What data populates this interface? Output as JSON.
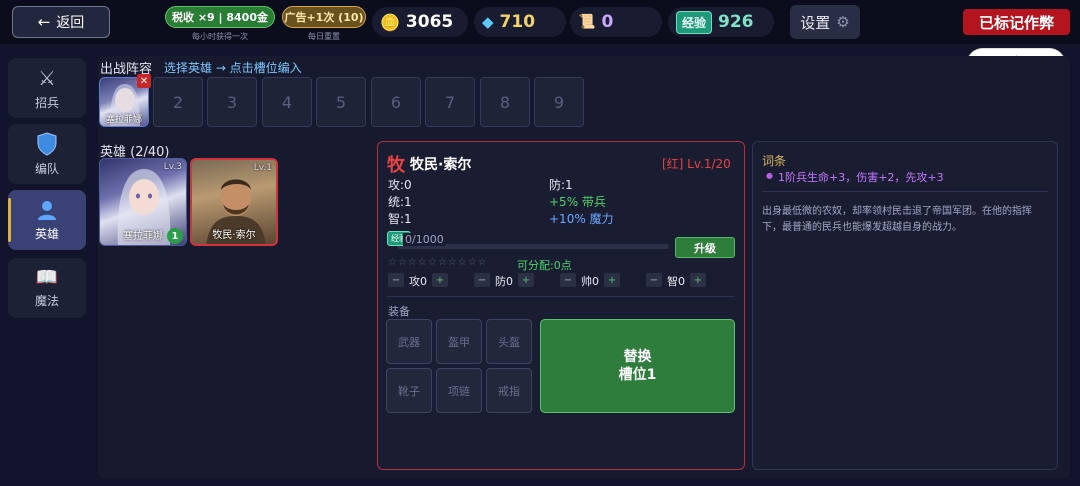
{
  "topbar": {
    "back_label": "返回",
    "tax_label": "税收 ×9 | 8400金",
    "tax_sub": "每小时获得一次",
    "ad_label": "广告+1次 (10)",
    "ad_sub": "每日重置",
    "gold": "3065",
    "gems": "710",
    "scrolls": "0",
    "exp_tag": "经验",
    "exp": "926",
    "settings_label": "设置",
    "cheat_label": "已标记作弊"
  },
  "sidebar": {
    "items": [
      {
        "label": "招兵",
        "icon": "crossed-swords-icon"
      },
      {
        "label": "编队",
        "icon": "shield-icon"
      },
      {
        "label": "英雄",
        "icon": "person-icon",
        "active": true
      },
      {
        "label": "魔法",
        "icon": "book-icon"
      }
    ]
  },
  "lineup": {
    "title": "出战阵容",
    "hint": "选择英雄 → 点击槽位编入",
    "slot1_name": "塞拉菲娜",
    "slots": [
      "2",
      "3",
      "4",
      "5",
      "6",
      "7",
      "8",
      "9"
    ]
  },
  "heroes": {
    "title": "英雄 (2/40)",
    "list": [
      {
        "name": "塞拉菲娜",
        "level": "Lv.3",
        "badge": "1"
      },
      {
        "name": "牧民·索尔",
        "level": "Lv.1"
      }
    ]
  },
  "detail": {
    "class_char": "牧",
    "name": "牧民·索尔",
    "rarity_level": "[红] Lv.1/20",
    "attack": "攻:0",
    "defense": "防:1",
    "command": "统:1",
    "command_bonus": "+5% 带兵",
    "intellect": "智:1",
    "intellect_bonus": "+10% 魔力",
    "exp_tag": "经验",
    "exp_value": "0/1000",
    "exp_progress": 0,
    "upgrade_label": "升级",
    "stars": "☆☆☆☆☆☆☆☆☆☆",
    "allocatable": "可分配:0点",
    "alloc": [
      {
        "label": "攻0"
      },
      {
        "label": "防0"
      },
      {
        "label": "帅0"
      },
      {
        "label": "智0"
      }
    ],
    "equipment_title": "装备",
    "equipment": [
      "武器",
      "盔甲",
      "头盔",
      "靴子",
      "项链",
      "戒指"
    ],
    "replace_line1": "替换",
    "replace_line2": "槽位1"
  },
  "traits": {
    "title": "词条",
    "item": "1阶兵生命+3，伤害+2，先攻+3",
    "description": "出身最低微的农奴，却率领村民击退了帝国军团。在他的指挥下，最普通的民兵也能爆发超越自身的战力。"
  }
}
